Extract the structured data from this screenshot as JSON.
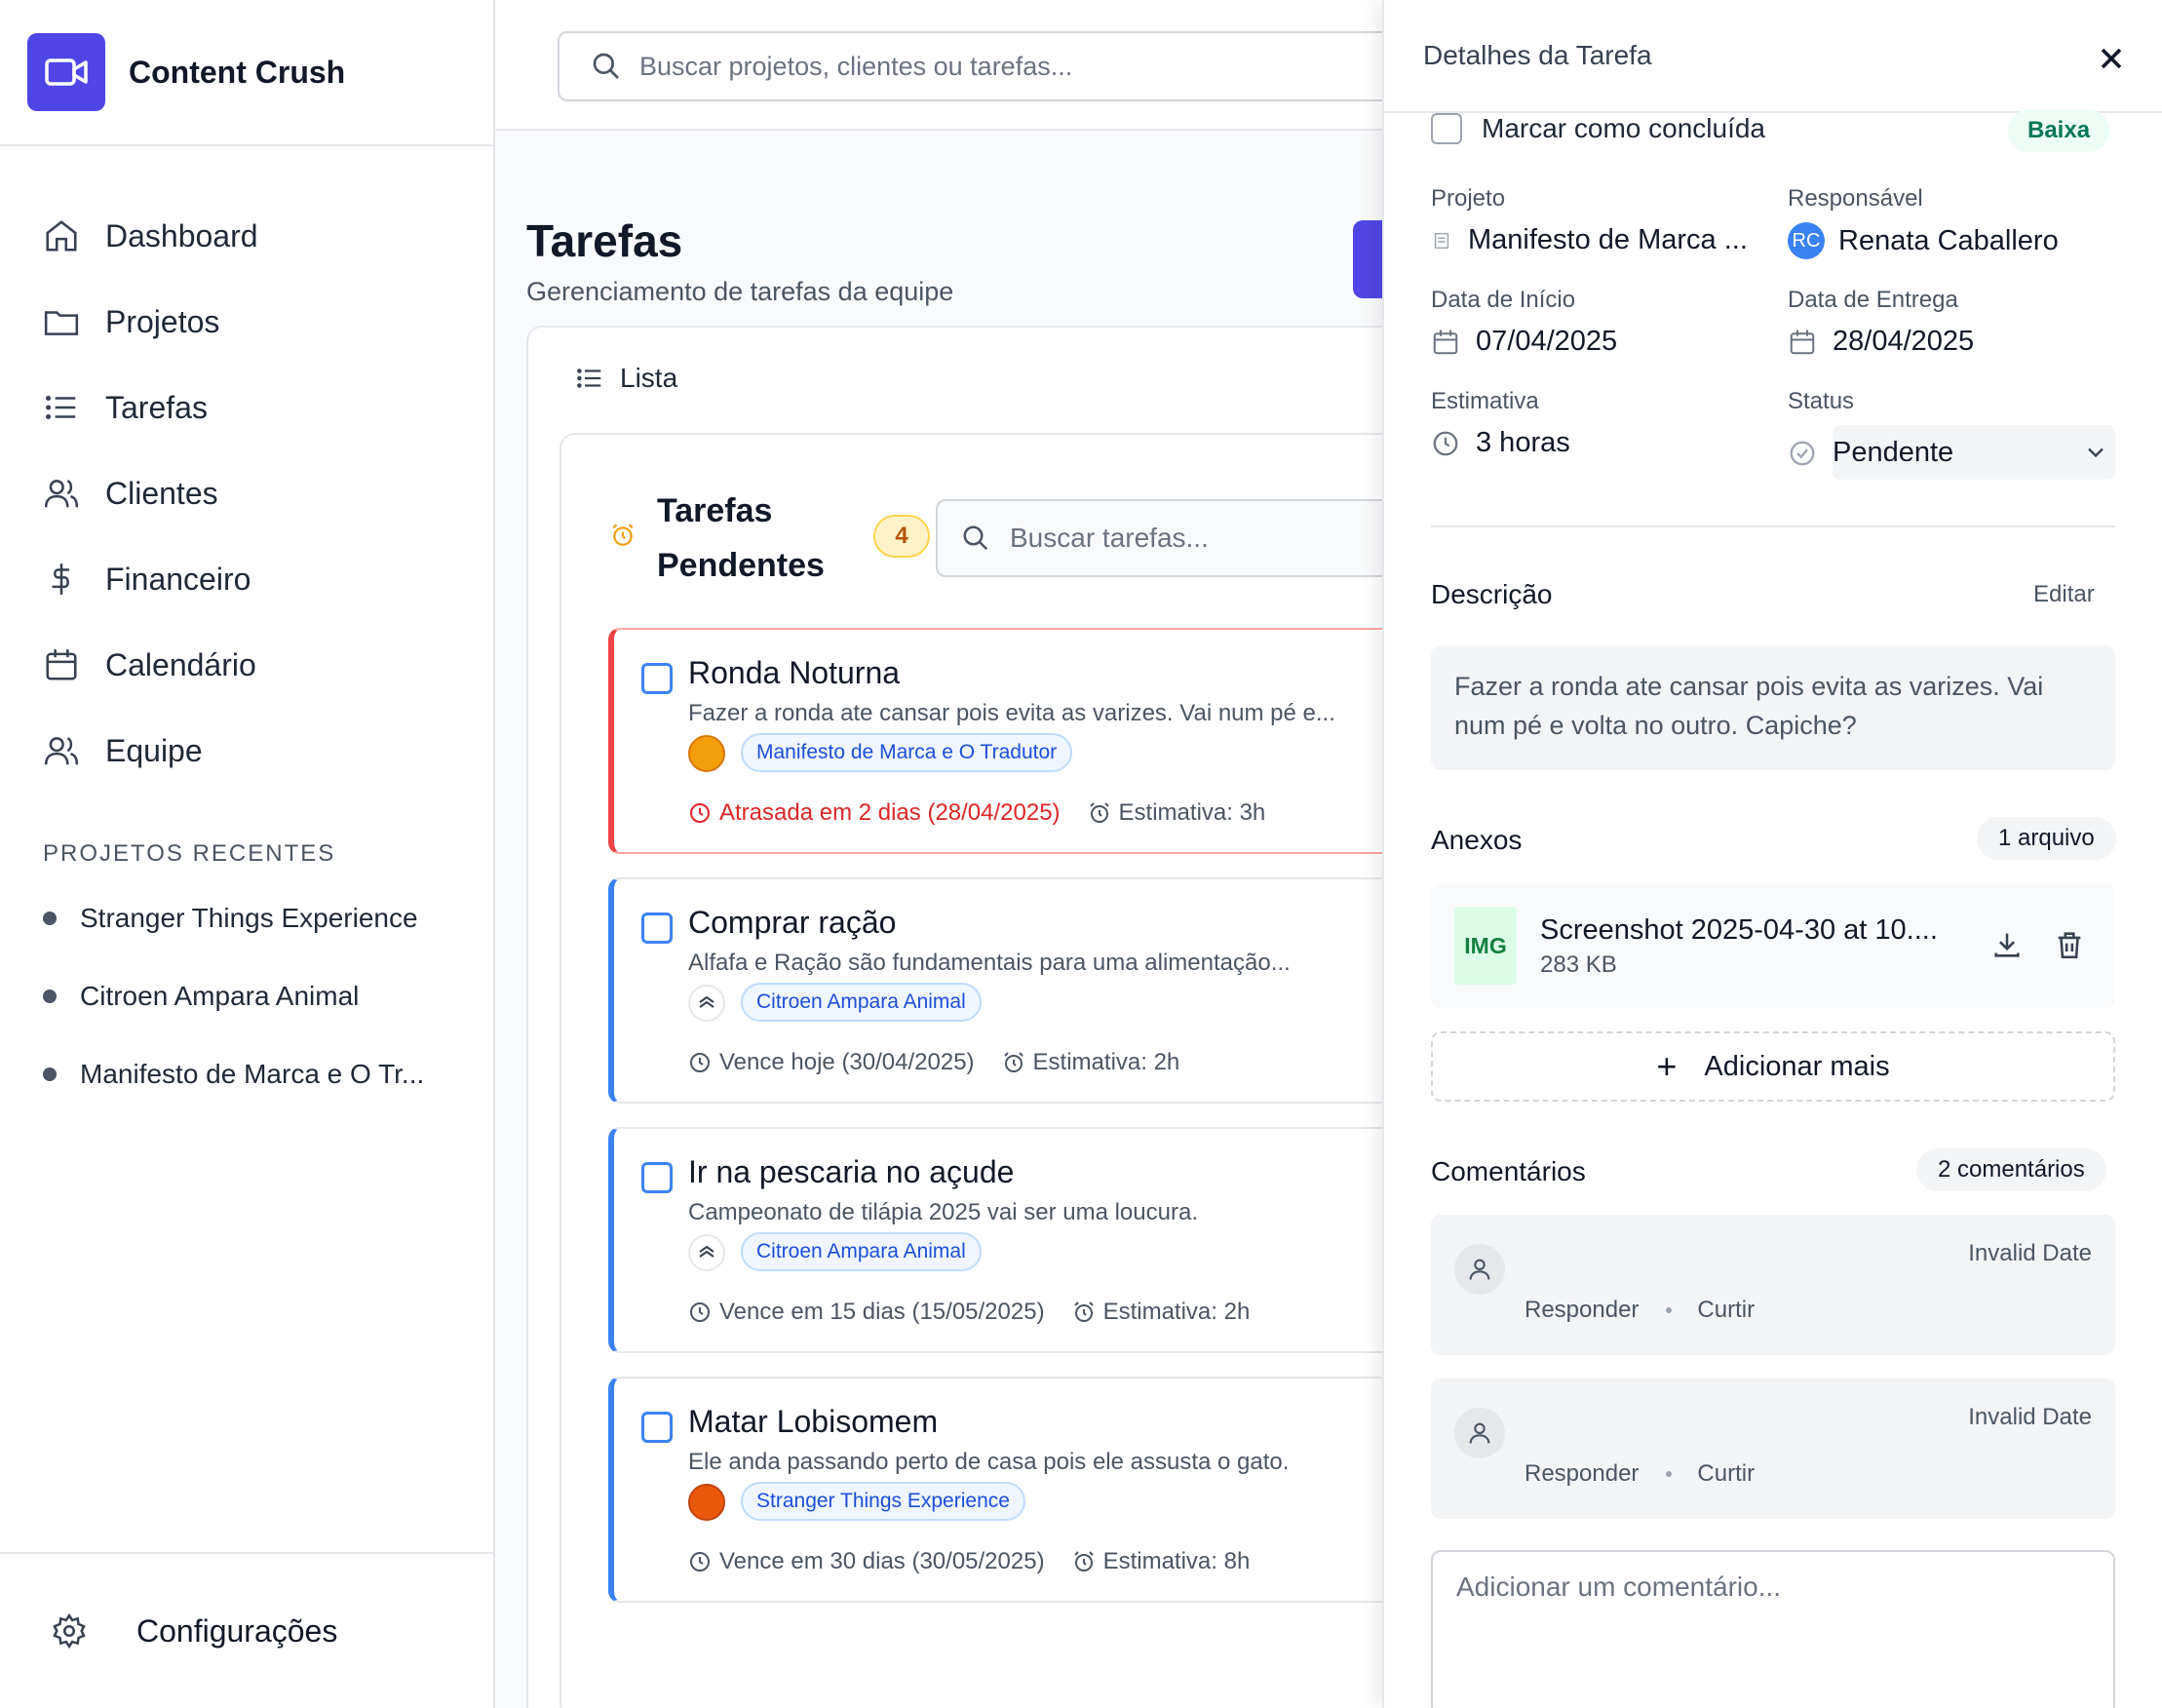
{
  "app": {
    "name": "Content Crush"
  },
  "sidebar": {
    "nav": [
      {
        "label": "Dashboard",
        "icon": "home-icon"
      },
      {
        "label": "Projetos",
        "icon": "folder-icon"
      },
      {
        "label": "Tarefas",
        "icon": "list-icon"
      },
      {
        "label": "Clientes",
        "icon": "users-icon"
      },
      {
        "label": "Financeiro",
        "icon": "dollar-icon"
      },
      {
        "label": "Calendário",
        "icon": "calendar-icon"
      },
      {
        "label": "Equipe",
        "icon": "team-icon"
      }
    ],
    "recent_title": "PROJETOS RECENTES",
    "recent": [
      "Stranger Things Experience",
      "Citroen Ampara Animal",
      "Manifesto de Marca e O Tr..."
    ],
    "settings_label": "Configurações"
  },
  "header": {
    "search_placeholder": "Buscar projetos, clientes ou tarefas..."
  },
  "page": {
    "title": "Tarefas",
    "subtitle": "Gerenciamento de tarefas da equipe",
    "view_label": "Lista"
  },
  "pending": {
    "title": "Tarefas Pendentes",
    "count": "4",
    "search_placeholder": "Buscar tarefas...",
    "tasks": [
      {
        "title": "Ronda Noturna",
        "desc": "Fazer a ronda ate cansar pois evita as varizes. Vai num pé e...",
        "project": "Manifesto de Marca e O Tradutor",
        "due": "Atrasada em 2 dias (28/04/2025)",
        "estimate": "Estimativa: 3h",
        "late": true,
        "priority_color": "#10b981"
      },
      {
        "title": "Comprar ração",
        "desc": "Alfafa e Ração são fundamentais para uma alimentação...",
        "project": "Citroen Ampara Animal",
        "due": "Vence hoje (30/04/2025)",
        "estimate": "Estimativa: 2h",
        "late": false,
        "priority_color": "#f59e0b"
      },
      {
        "title": "Ir na pescaria no açude",
        "desc": "Campeonato de tilápia 2025 vai ser uma loucura.",
        "project": "Citroen Ampara Animal",
        "due": "Vence em 15 dias (15/05/2025)",
        "estimate": "Estimativa: 2h",
        "late": false,
        "priority_color": ""
      },
      {
        "title": "Matar Lobisomem",
        "desc": "Ele anda passando perto de casa pois ele assusta o gato.",
        "project": "Stranger Things Experience",
        "due": "Vence em 30 dias (30/05/2025)",
        "estimate": "Estimativa: 8h",
        "late": false,
        "priority_color": "#dc2626"
      }
    ]
  },
  "detail": {
    "header": "Detalhes da Tarefa",
    "mark_done": "Marcar como concluída",
    "priority": "Baixa",
    "project_label": "Projeto",
    "project_value": "Manifesto de Marca ...",
    "assignee_label": "Responsável",
    "assignee_initials": "RC",
    "assignee_value": "Renata Caballero",
    "start_label": "Data de Início",
    "start_value": "07/04/2025",
    "due_label": "Data de Entrega",
    "due_value": "28/04/2025",
    "estimate_label": "Estimativa",
    "estimate_value": "3 horas",
    "status_label": "Status",
    "status_value": "Pendente",
    "description_title": "Descrição",
    "edit_label": "Editar",
    "description": "Fazer a ronda ate cansar pois evita as varizes. Vai num pé e volta no outro. Capiche?",
    "attachments_title": "Anexos",
    "attachments_count": "1 arquivo",
    "attachment": {
      "type": "IMG",
      "name": "Screenshot 2025-04-30 at 10....",
      "size": "283 KB"
    },
    "add_more": "Adicionar mais",
    "comments_title": "Comentários",
    "comments_count": "2 comentários",
    "comments": [
      {
        "date": "Invalid Date",
        "reply": "Responder",
        "like": "Curtir"
      },
      {
        "date": "Invalid Date",
        "reply": "Responder",
        "like": "Curtir"
      }
    ],
    "comment_placeholder": "Adicionar um comentário..."
  },
  "colors": {
    "accent": "#4f46e5",
    "late": "#dc2626",
    "task_border": "#3b82f6"
  }
}
